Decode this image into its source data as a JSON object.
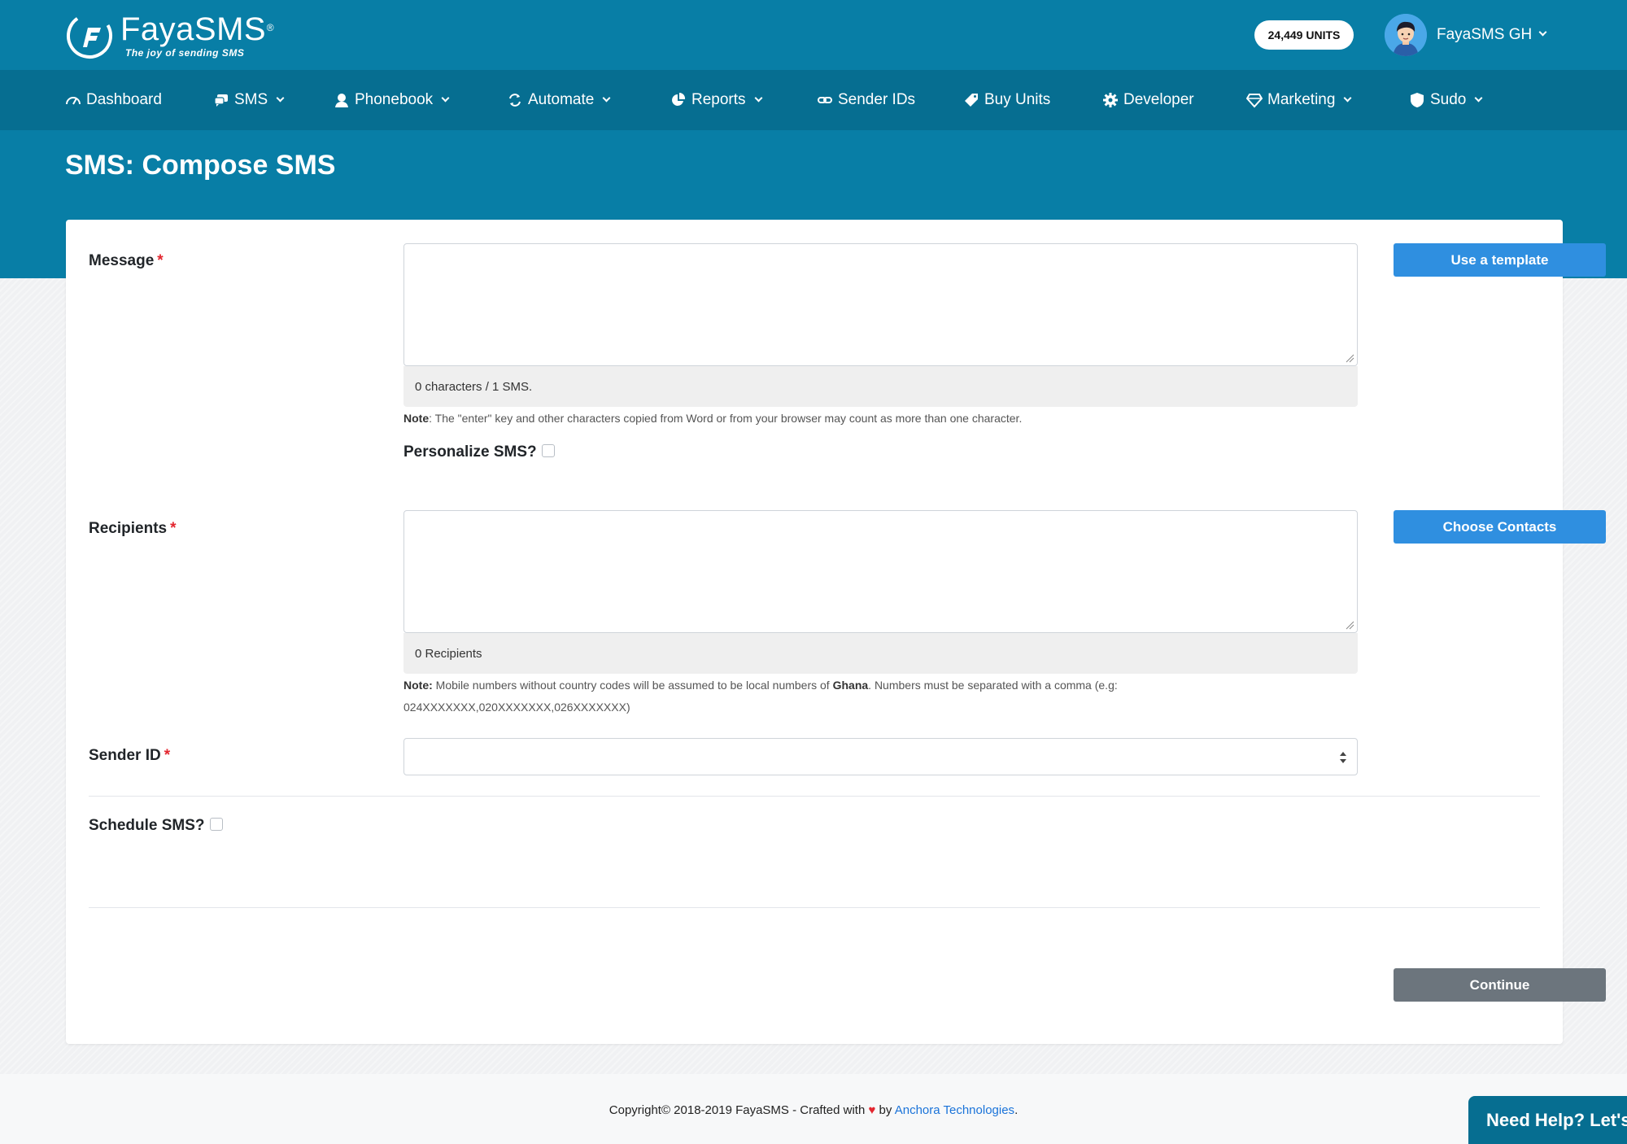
{
  "brand": {
    "name": "FayaSMS",
    "registered_mark": "®",
    "tagline": "The joy of sending SMS",
    "colors": {
      "header": "#087ea6",
      "navbar": "#066e91",
      "primary_button": "#2f8fe0",
      "secondary_button": "#6c757d",
      "required": "#e3262f"
    }
  },
  "header": {
    "units_badge": "24,449 UNITS",
    "user_name": "FayaSMS GH"
  },
  "nav": {
    "items": [
      {
        "label": "Dashboard",
        "icon": "speedometer-icon",
        "dropdown": false
      },
      {
        "label": "SMS",
        "icon": "chat-bubbles-icon",
        "dropdown": true
      },
      {
        "label": "Phonebook",
        "icon": "person-icon",
        "dropdown": true
      },
      {
        "label": "Automate",
        "icon": "sync-icon",
        "dropdown": true
      },
      {
        "label": "Reports",
        "icon": "pie-chart-icon",
        "dropdown": true
      },
      {
        "label": "Sender IDs",
        "icon": "link-icon",
        "dropdown": false
      },
      {
        "label": "Buy Units",
        "icon": "tag-icon",
        "dropdown": false
      },
      {
        "label": "Developer",
        "icon": "gear-icon",
        "dropdown": false
      },
      {
        "label": "Marketing",
        "icon": "diamond-icon",
        "dropdown": true
      },
      {
        "label": "Sudo",
        "icon": "shield-icon",
        "dropdown": true
      }
    ]
  },
  "page": {
    "title": "SMS: Compose SMS"
  },
  "form": {
    "message": {
      "label": "Message",
      "required_mark": "*",
      "value": "",
      "counter": "0 characters / 1 SMS.",
      "note_label": "Note",
      "note_text": ": The \"enter\" key and other characters copied from Word or from your browser may count as more than one character.",
      "template_button": "Use a template"
    },
    "personalize": {
      "label": "Personalize SMS?",
      "checked": false
    },
    "recipients": {
      "label": "Recipients",
      "required_mark": "*",
      "value": "",
      "counter": "0 Recipients",
      "note_label": "Note:",
      "note_text_1": " Mobile numbers without country codes will be assumed to be local numbers of ",
      "note_country": "Ghana",
      "note_text_2": ". Numbers must be separated with a comma (e.g:",
      "note_example": "024XXXXXXX,020XXXXXXX,026XXXXXXX)",
      "contacts_button": "Choose Contacts"
    },
    "sender_id": {
      "label": "Sender ID",
      "required_mark": "*",
      "selected": ""
    },
    "schedule": {
      "label": "Schedule SMS?",
      "checked": false
    },
    "continue_button": "Continue"
  },
  "footer": {
    "copyright_prefix": "Copyright© 2018-2019 FayaSMS - Crafted with",
    "heart": "♥",
    "by": "by",
    "company_link": "Anchora Technologies",
    "suffix": "."
  },
  "help_widget": {
    "label": "Need Help? Let's Chat"
  }
}
